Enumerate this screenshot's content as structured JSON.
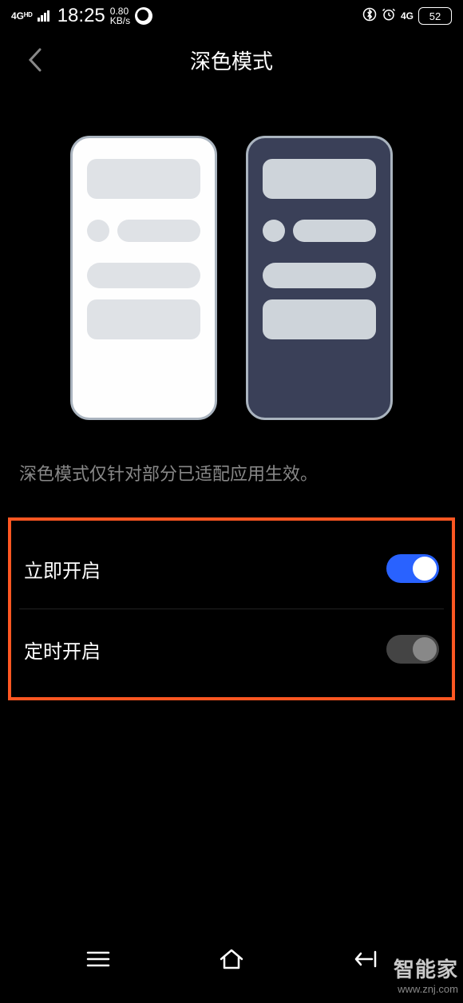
{
  "status_bar": {
    "signal_label": "4Gᴴᴰ",
    "time": "18:25",
    "speed_value": "0.80",
    "speed_unit": "KB/s",
    "network": "4G",
    "battery": "52"
  },
  "header": {
    "title": "深色模式"
  },
  "description": "深色模式仅针对部分已适配应用生效。",
  "settings": [
    {
      "label": "立即开启",
      "enabled": true
    },
    {
      "label": "定时开启",
      "enabled": false
    }
  ],
  "watermark": {
    "main": "智能家",
    "sub": "www.znj.com"
  }
}
